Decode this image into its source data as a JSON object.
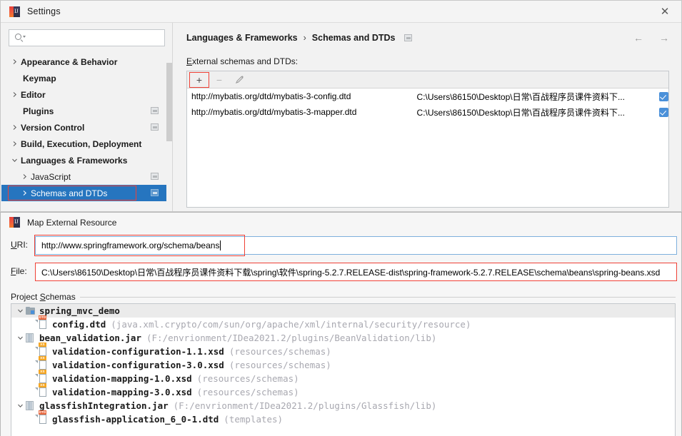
{
  "settings_window": {
    "title": "Settings",
    "icon": "intellij-idea-icon",
    "close_label": "✕",
    "search": {
      "placeholder": "",
      "value": "",
      "icon": "search-icon"
    },
    "sidebar": {
      "items": [
        {
          "label": "Appearance & Behavior",
          "arrow": "collapsed",
          "indent": false,
          "badge": false,
          "selected": false
        },
        {
          "label": "Keymap",
          "arrow": "none",
          "indent": false,
          "badge": false,
          "selected": false
        },
        {
          "label": "Editor",
          "arrow": "collapsed",
          "indent": false,
          "badge": false,
          "selected": false
        },
        {
          "label": "Plugins",
          "arrow": "none",
          "indent": false,
          "badge": true,
          "selected": false
        },
        {
          "label": "Version Control",
          "arrow": "collapsed",
          "indent": false,
          "badge": true,
          "selected": false
        },
        {
          "label": "Build, Execution, Deployment",
          "arrow": "collapsed",
          "indent": false,
          "badge": false,
          "selected": false
        },
        {
          "label": "Languages & Frameworks",
          "arrow": "expanded",
          "indent": false,
          "badge": false,
          "selected": false
        },
        {
          "label": "JavaScript",
          "arrow": "collapsed",
          "indent": true,
          "badge": true,
          "selected": false
        },
        {
          "label": "Schemas and DTDs",
          "arrow": "collapsed",
          "indent": true,
          "badge": true,
          "selected": true
        }
      ]
    },
    "content": {
      "breadcrumb": {
        "parent": "Languages & Frameworks",
        "separator": "›",
        "current": "Schemas and DTDs"
      },
      "nav": {
        "back": "←",
        "forward": "→"
      },
      "section_label": "External schemas and DTDs:",
      "section_label_mnemonic": "E",
      "toolbar": {
        "add": "+",
        "remove": "−",
        "edit": "edit-pencil-icon"
      },
      "table": {
        "rows": [
          {
            "uri": "http://mybatis.org/dtd/mybatis-3-config.dtd",
            "location": "C:\\Users\\86150\\Desktop\\日常\\百战程序员课件资料下...",
            "checked": true
          },
          {
            "uri": "http://mybatis.org/dtd/mybatis-3-mapper.dtd",
            "location": "C:\\Users\\86150\\Desktop\\日常\\百战程序员课件资料下...",
            "checked": true
          }
        ]
      }
    }
  },
  "dialog": {
    "title": "Map External Resource",
    "icon": "intellij-idea-icon",
    "uri": {
      "label": "URI:",
      "mnemonic": "U",
      "value": "http://www.springframework.org/schema/beans"
    },
    "file": {
      "label": "File:",
      "mnemonic": "F",
      "value": "C:\\Users\\86150\\Desktop\\日常\\百战程序员课件资料下载\\spring\\软件\\spring-5.2.7.RELEASE-dist\\spring-framework-5.2.7.RELEASE\\schema\\beans\\spring-beans.xsd"
    },
    "group_label": "Project Schemas",
    "group_mnemonic": "S",
    "tree": {
      "rows": [
        {
          "arrow": "expanded",
          "icon": "folder-module-icon",
          "name": "spring_mvc_demo",
          "meta": "",
          "selected": true,
          "indent": 0
        },
        {
          "arrow": "none",
          "icon": "dtd-file-icon",
          "name": "config.dtd",
          "meta": "(java.xml.crypto/com/sun/org/apache/xml/internal/security/resource)",
          "selected": false,
          "indent": 1
        },
        {
          "arrow": "expanded",
          "icon": "jar-icon",
          "name": "bean_validation.jar",
          "meta": "(F:/envrionment/IDea2021.2/plugins/BeanValidation/lib)",
          "selected": false,
          "indent": 0
        },
        {
          "arrow": "none",
          "icon": "xsd-file-icon",
          "name": "validation-configuration-1.1.xsd",
          "meta": "(resources/schemas)",
          "selected": false,
          "indent": 1
        },
        {
          "arrow": "none",
          "icon": "xsd-file-icon",
          "name": "validation-configuration-3.0.xsd",
          "meta": "(resources/schemas)",
          "selected": false,
          "indent": 1
        },
        {
          "arrow": "none",
          "icon": "xsd-file-icon",
          "name": "validation-mapping-1.0.xsd",
          "meta": "(resources/schemas)",
          "selected": false,
          "indent": 1
        },
        {
          "arrow": "none",
          "icon": "xsd-file-icon",
          "name": "validation-mapping-3.0.xsd",
          "meta": "(resources/schemas)",
          "selected": false,
          "indent": 1
        },
        {
          "arrow": "expanded",
          "icon": "jar-icon",
          "name": "glassfishIntegration.jar",
          "meta": "(F:/envrionment/IDea2021.2/plugins/Glassfish/lib)",
          "selected": false,
          "indent": 0
        },
        {
          "arrow": "none",
          "icon": "dtd-file-icon",
          "name": "glassfish-application_6_0-1.dtd",
          "meta": "(templates)",
          "selected": false,
          "indent": 1
        }
      ]
    }
  },
  "colors": {
    "selection_blue": "#2675bf",
    "highlight_red": "#ef4136",
    "checkbox_blue": "#4a90d9",
    "focus_border": "#7eb0dd",
    "tree_meta_gray": "#a8a8b0"
  }
}
